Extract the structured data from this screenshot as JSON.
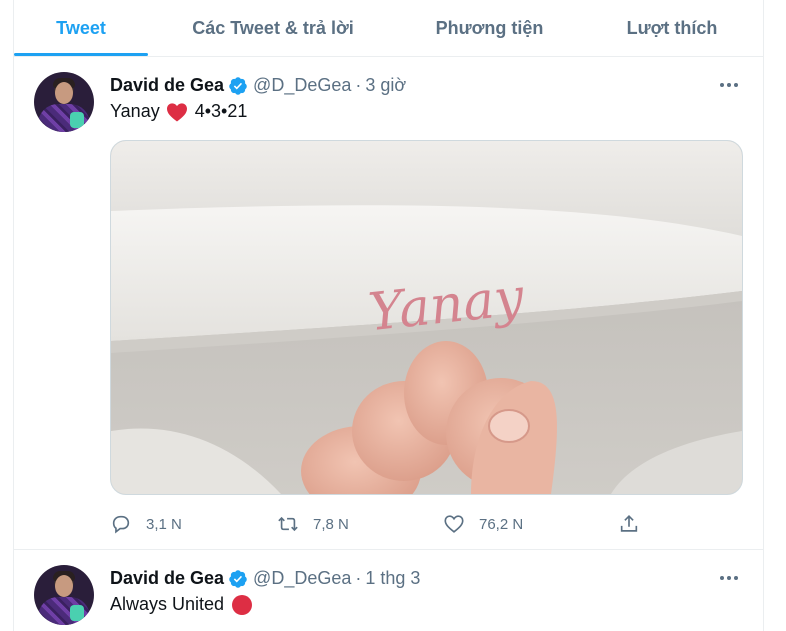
{
  "tabs": [
    {
      "label": "Tweet",
      "active": true
    },
    {
      "label": "Các Tweet & trả lời",
      "active": false
    },
    {
      "label": "Phương tiện",
      "active": false
    },
    {
      "label": "Lượt thích",
      "active": false
    }
  ],
  "tweets": [
    {
      "author_name": "David de Gea",
      "handle": "@D_DeGea",
      "separator": "·",
      "time": "3 giờ",
      "text": "Yanay",
      "text_suffix": "4•3•21",
      "emoji": "red-heart",
      "media_caption": "Yanay",
      "replies": "3,1 N",
      "retweets": "7,8 N",
      "likes": "76,2 N"
    },
    {
      "author_name": "David de Gea",
      "handle": "@D_DeGea",
      "separator": "·",
      "time": "1 thg 3",
      "text": "Always United",
      "emoji": "red-circle"
    }
  ],
  "colors": {
    "accent": "#1da1f2",
    "secondary_text": "#5b7083",
    "border": "#ebeef0",
    "heart": "#dd2e44"
  },
  "icons": [
    "verified-badge-icon",
    "more-options-icon",
    "reply-icon",
    "retweet-icon",
    "like-icon",
    "share-icon"
  ]
}
